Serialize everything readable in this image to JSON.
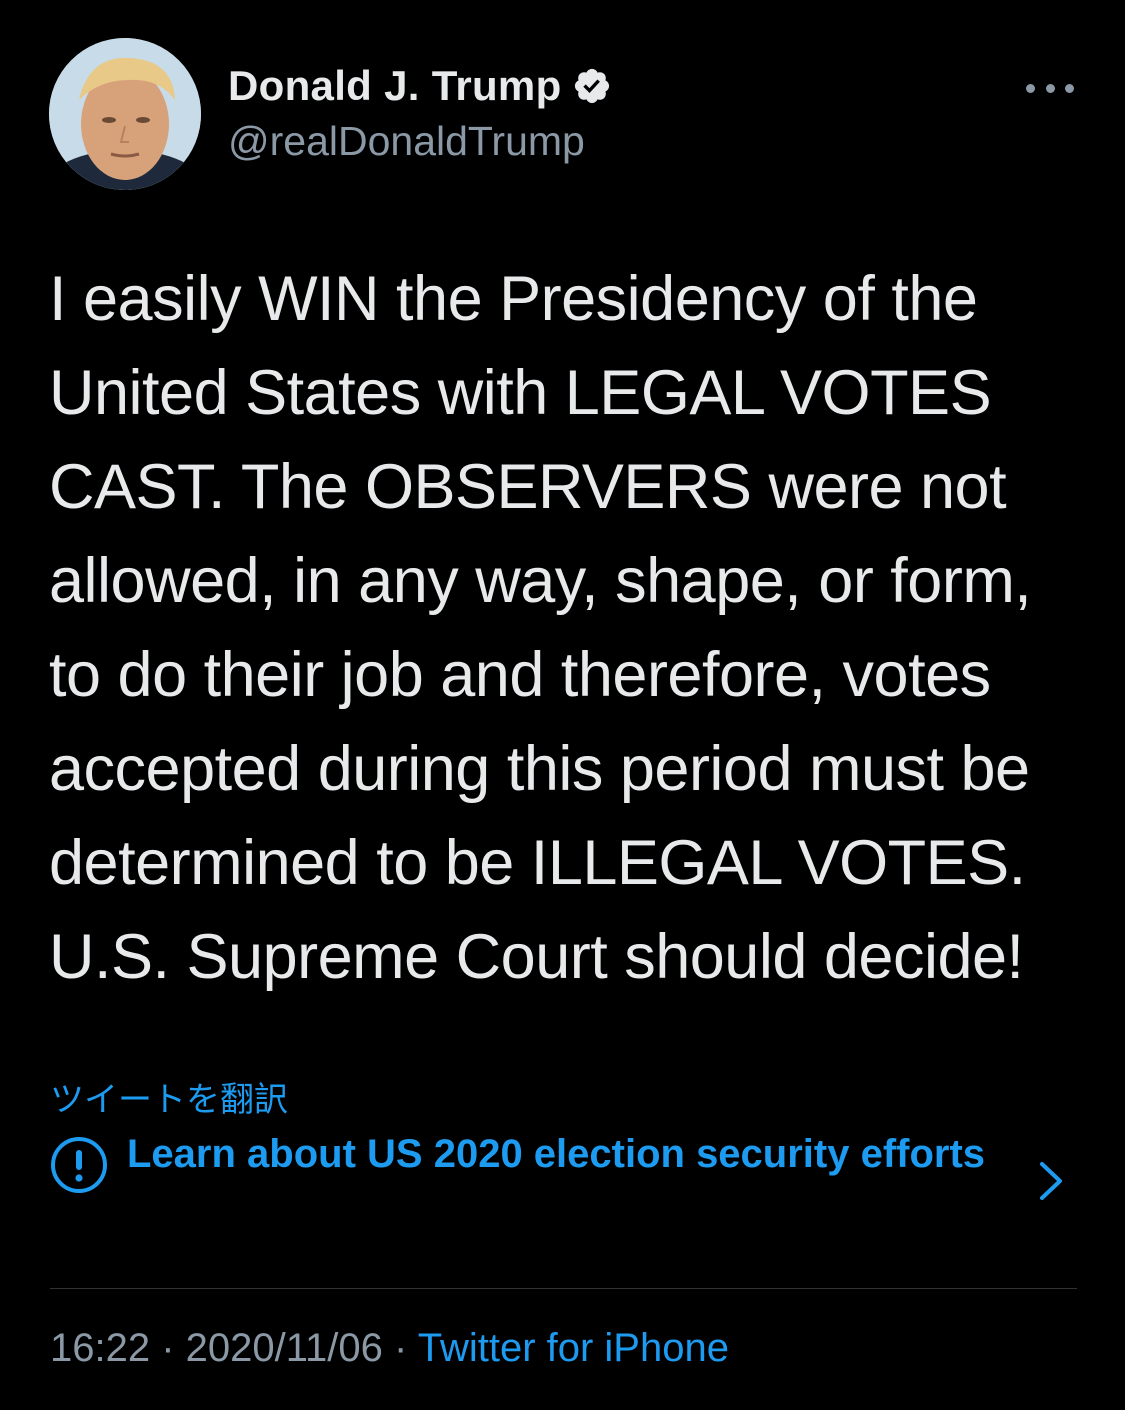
{
  "colors": {
    "background": "#000000",
    "text_primary": "#e7e9ea",
    "text_secondary": "#8b98a5",
    "accent": "#1d9bf0",
    "divider": "#2f3336"
  },
  "author": {
    "display_name": "Donald J. Trump",
    "handle": "@realDonaldTrump",
    "avatar_icon": "profile-photo",
    "verified_icon": "verified-badge-icon"
  },
  "more_icon": "more-horizontal-icon",
  "tweet": {
    "text": "I easily WIN the Presidency of the\nUnited States with LEGAL VOTES\nCAST. The OBSERVERS were not\nallowed, in any way, shape, or form,\nto do their job and therefore, votes\naccepted during this period must be\ndetermined to be ILLEGAL VOTES.\nU.S. Supreme Court should decide!"
  },
  "translate_label": "ツイートを翻訳",
  "notice": {
    "icon": "exclamation-circle-icon",
    "text": "Learn about US 2020 election security efforts",
    "chevron_icon": "chevron-right-icon"
  },
  "meta": {
    "time": "16:22",
    "separator": " · ",
    "date": "2020/11/06",
    "source": "Twitter for iPhone"
  }
}
